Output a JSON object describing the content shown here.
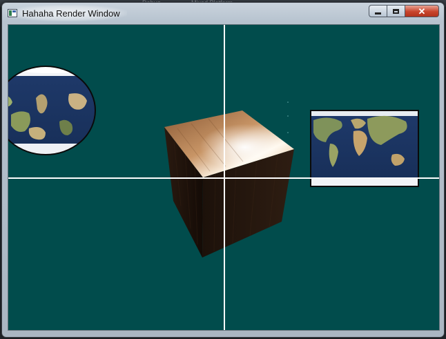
{
  "window": {
    "title": "Hahaha Render Window",
    "controls": {
      "minimize_icon": "minimize-icon",
      "maximize_icon": "maximize-icon",
      "close_icon": "close-icon"
    }
  },
  "background_ide": {
    "items": [
      "Debug",
      "Mixed Platform"
    ]
  },
  "scene": {
    "background_color": "#014c4c",
    "crosshair_color": "#ffffff",
    "objects": [
      "earth-ellipse",
      "wooden-cube",
      "earth-map-rect"
    ]
  }
}
